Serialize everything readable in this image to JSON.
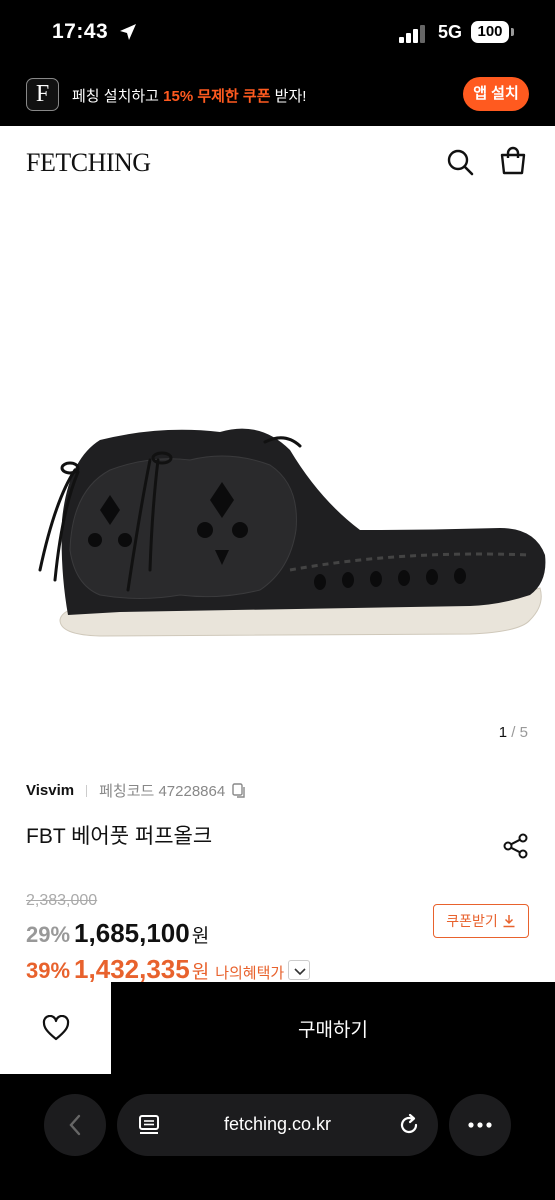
{
  "status_bar": {
    "time": "17:43",
    "network": "5G",
    "battery": "100"
  },
  "app_banner": {
    "logo_letter": "F",
    "text_before": "페칭 설치하고 ",
    "text_highlight": "15% 무제한 쿠폰",
    "text_after": " 받자!",
    "install_label": "앱 설치"
  },
  "header": {
    "logo": "FETCHING"
  },
  "gallery": {
    "current": "1",
    "separator": " / ",
    "total": "5"
  },
  "product": {
    "brand": "Visvim",
    "code_label": "페칭코드 47228864",
    "title": "FBT 베어풋 퍼프올크",
    "original_price": "2,383,000",
    "discount": "29%",
    "price": "1,685,100",
    "currency": "원",
    "coupon_label": "쿠폰받기",
    "benefit_discount": "39%",
    "benefit_price": "1,432,335",
    "benefit_currency": "원",
    "benefit_label": "나의혜택가"
  },
  "buy_bar": {
    "buy_label": "구매하기"
  },
  "browser": {
    "url": "fetching.co.kr"
  },
  "colors": {
    "accent": "#ff5a1f",
    "benefit": "#e8622d"
  }
}
